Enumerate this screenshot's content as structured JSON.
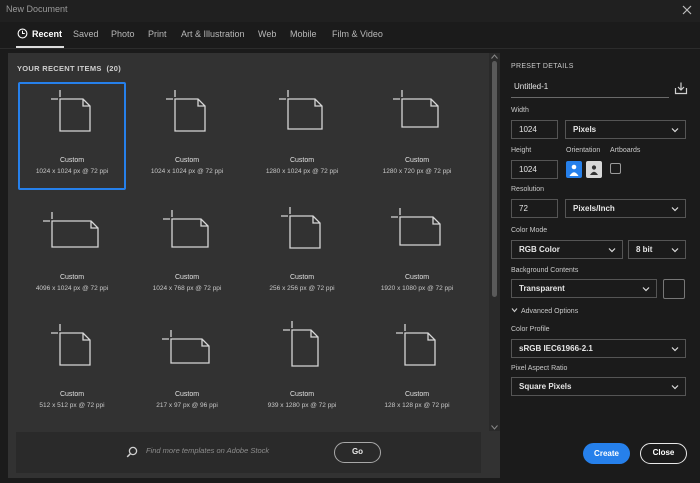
{
  "window": {
    "title": "New Document"
  },
  "tabs": [
    {
      "label": "Recent",
      "active": true
    },
    {
      "label": "Saved",
      "active": false
    },
    {
      "label": "Photo",
      "active": false
    },
    {
      "label": "Print",
      "active": false
    },
    {
      "label": "Art & Illustration",
      "active": false
    },
    {
      "label": "Web",
      "active": false
    },
    {
      "label": "Mobile",
      "active": false
    },
    {
      "label": "Film & Video",
      "active": false
    }
  ],
  "recent": {
    "title": "YOUR RECENT ITEMS",
    "count": "(20)",
    "title_full": "YOUR RECENT ITEMS  (20)",
    "items": [
      {
        "name": "Custom",
        "dims": "1024 x 1024 px @ 72 ppi",
        "selected": true
      },
      {
        "name": "Custom",
        "dims": "1024 x 1024 px @ 72 ppi"
      },
      {
        "name": "Custom",
        "dims": "1280 x 1024 px @ 72 ppi"
      },
      {
        "name": "Custom",
        "dims": "1280 x 720 px @ 72 ppi"
      },
      {
        "name": "Custom",
        "dims": "4096 x 1024 px @ 72 ppi"
      },
      {
        "name": "Custom",
        "dims": "1024 x 768 px @ 72 ppi"
      },
      {
        "name": "Custom",
        "dims": "256 x 256 px @ 72 ppi"
      },
      {
        "name": "Custom",
        "dims": "1920 x 1080 px @ 72 ppi"
      },
      {
        "name": "Custom",
        "dims": "512 x 512 px @ 72 ppi"
      },
      {
        "name": "Custom",
        "dims": "217 x 97 px @ 96 ppi"
      },
      {
        "name": "Custom",
        "dims": "939 x 1280 px @ 72 ppi"
      },
      {
        "name": "Custom",
        "dims": "128 x 128 px @ 72 ppi"
      }
    ]
  },
  "search": {
    "placeholder": "Find more templates on Adobe Stock",
    "go_label": "Go"
  },
  "preset": {
    "section_title": "PRESET DETAILS",
    "doc_name": "Untitled-1",
    "width_label": "Width",
    "width_value": "1024",
    "width_unit": "Pixels",
    "height_label": "Height",
    "height_value": "1024",
    "orientation_label": "Orientation",
    "artboards_label": "Artboards",
    "resolution_label": "Resolution",
    "resolution_value": "72",
    "resolution_unit": "Pixels/Inch",
    "color_mode_label": "Color Mode",
    "color_mode": "RGB Color",
    "bit_depth": "8 bit",
    "bg_label": "Background Contents",
    "bg_value": "Transparent",
    "advanced_label": "Advanced Options",
    "profile_label": "Color Profile",
    "profile_value": "sRGB IEC61966-2.1",
    "aspect_label": "Pixel Aspect Ratio",
    "aspect_value": "Square Pixels",
    "orientation_selected": "portrait",
    "artboards_checked": false
  },
  "actions": {
    "create_label": "Create",
    "close_label": "Close"
  },
  "colors": {
    "accent": "#2680eb",
    "panel": "#323232",
    "background": "#1b1b1b"
  },
  "icons": [
    "close-icon",
    "clock-icon",
    "document-icon",
    "search-icon",
    "save-preset-icon",
    "chevron-down-icon",
    "portrait-icon",
    "landscape-icon"
  ]
}
